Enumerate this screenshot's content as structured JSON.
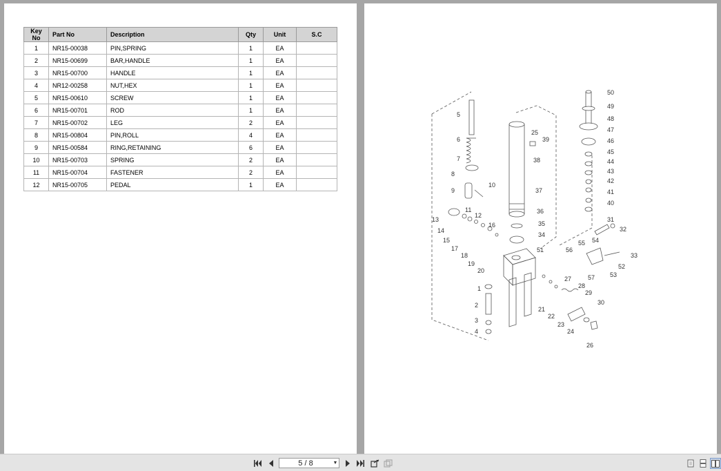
{
  "table": {
    "headers": {
      "key": "Key No",
      "part": "Part No",
      "desc": "Description",
      "qty": "Qty",
      "unit": "Unit",
      "sc": "S.C"
    },
    "rows": [
      {
        "key": "1",
        "part": "NR15-00038",
        "desc": "PIN,SPRING",
        "qty": "1",
        "unit": "EA",
        "sc": ""
      },
      {
        "key": "2",
        "part": "NR15-00699",
        "desc": "BAR,HANDLE",
        "qty": "1",
        "unit": "EA",
        "sc": ""
      },
      {
        "key": "3",
        "part": "NR15-00700",
        "desc": "HANDLE",
        "qty": "1",
        "unit": "EA",
        "sc": ""
      },
      {
        "key": "4",
        "part": "NR12-00258",
        "desc": "NUT,HEX",
        "qty": "1",
        "unit": "EA",
        "sc": ""
      },
      {
        "key": "5",
        "part": "NR15-00610",
        "desc": "SCREW",
        "qty": "1",
        "unit": "EA",
        "sc": ""
      },
      {
        "key": "6",
        "part": "NR15-00701",
        "desc": "ROD",
        "qty": "1",
        "unit": "EA",
        "sc": ""
      },
      {
        "key": "7",
        "part": "NR15-00702",
        "desc": "LEG",
        "qty": "2",
        "unit": "EA",
        "sc": ""
      },
      {
        "key": "8",
        "part": "NR15-00804",
        "desc": "PIN,ROLL",
        "qty": "4",
        "unit": "EA",
        "sc": ""
      },
      {
        "key": "9",
        "part": "NR15-00584",
        "desc": "RING,RETAINING",
        "qty": "6",
        "unit": "EA",
        "sc": ""
      },
      {
        "key": "10",
        "part": "NR15-00703",
        "desc": "SPRING",
        "qty": "2",
        "unit": "EA",
        "sc": ""
      },
      {
        "key": "11",
        "part": "NR15-00704",
        "desc": "FASTENER",
        "qty": "2",
        "unit": "EA",
        "sc": ""
      },
      {
        "key": "12",
        "part": "NR15-00705",
        "desc": "PEDAL",
        "qty": "1",
        "unit": "EA",
        "sc": ""
      }
    ]
  },
  "diagram": {
    "callouts": [
      "50",
      "49",
      "48",
      "47",
      "46",
      "45",
      "44",
      "43",
      "42",
      "41",
      "40",
      "5",
      "6",
      "7",
      "8",
      "9",
      "10",
      "25",
      "39",
      "38",
      "37",
      "36",
      "35",
      "34",
      "11",
      "12",
      "13",
      "14",
      "15",
      "16",
      "17",
      "18",
      "19",
      "20",
      "51",
      "56",
      "55",
      "54",
      "31",
      "32",
      "33",
      "52",
      "53",
      "57",
      "27",
      "28",
      "29",
      "30",
      "21",
      "22",
      "23",
      "24",
      "26",
      "1",
      "2",
      "3",
      "4"
    ]
  },
  "toolbar": {
    "page_indicator": "5 / 8",
    "icons": [
      "first-page-icon",
      "prev-page-icon",
      "next-page-icon",
      "last-page-icon",
      "go-back-icon",
      "go-forward-icon",
      "single-page-icon",
      "continuous-icon",
      "two-page-icon"
    ]
  }
}
